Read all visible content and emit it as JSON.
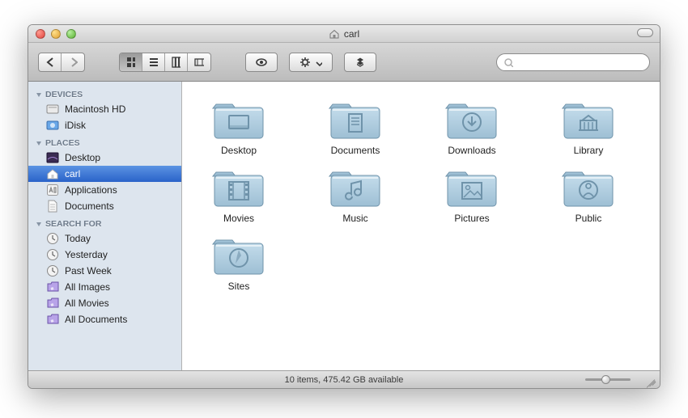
{
  "window": {
    "title": "carl"
  },
  "toolbar": {
    "search_placeholder": ""
  },
  "sidebar": {
    "sections": [
      {
        "label": "DEVICES",
        "items": [
          {
            "label": "Macintosh HD",
            "icon": "hd"
          },
          {
            "label": "iDisk",
            "icon": "idisk"
          }
        ]
      },
      {
        "label": "PLACES",
        "items": [
          {
            "label": "Desktop",
            "icon": "desktop"
          },
          {
            "label": "carl",
            "icon": "home",
            "selected": true
          },
          {
            "label": "Applications",
            "icon": "app"
          },
          {
            "label": "Documents",
            "icon": "doc"
          }
        ]
      },
      {
        "label": "SEARCH FOR",
        "items": [
          {
            "label": "Today",
            "icon": "clock"
          },
          {
            "label": "Yesterday",
            "icon": "clock"
          },
          {
            "label": "Past Week",
            "icon": "clock"
          },
          {
            "label": "All Images",
            "icon": "smart"
          },
          {
            "label": "All Movies",
            "icon": "smart"
          },
          {
            "label": "All Documents",
            "icon": "smart"
          }
        ]
      }
    ]
  },
  "content": {
    "items": [
      {
        "label": "Desktop",
        "glyph": "desktop"
      },
      {
        "label": "Documents",
        "glyph": "doc"
      },
      {
        "label": "Downloads",
        "glyph": "download"
      },
      {
        "label": "Library",
        "glyph": "library"
      },
      {
        "label": "Movies",
        "glyph": "movie"
      },
      {
        "label": "Music",
        "glyph": "music"
      },
      {
        "label": "Pictures",
        "glyph": "picture"
      },
      {
        "label": "Public",
        "glyph": "public"
      },
      {
        "label": "Sites",
        "glyph": "sites"
      }
    ]
  },
  "status": {
    "text": "10 items, 475.42 GB available"
  }
}
